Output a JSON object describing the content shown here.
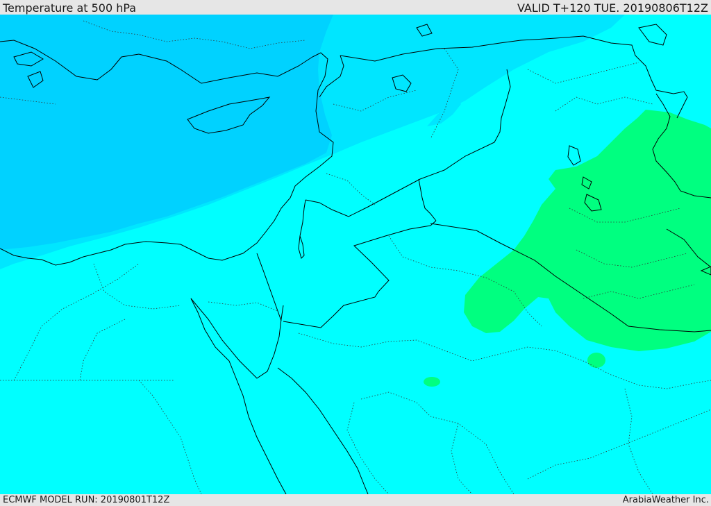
{
  "header": {
    "title": "Temperature at 500 hPa",
    "valid": "VALID T+120 TUE. 20190806T12Z"
  },
  "footer": {
    "model_run": "ECMWF MODEL RUN: 20190801T12Z",
    "credit": "ArabiaWeather Inc."
  },
  "map": {
    "field": "temperature-500hpa",
    "colors": {
      "base": "#00ffff",
      "cool_band": "#00e6ff",
      "coolest_band": "#00d2ff",
      "warm_area": "#00ff80",
      "border": "#000000",
      "coastline": "#000000"
    }
  }
}
